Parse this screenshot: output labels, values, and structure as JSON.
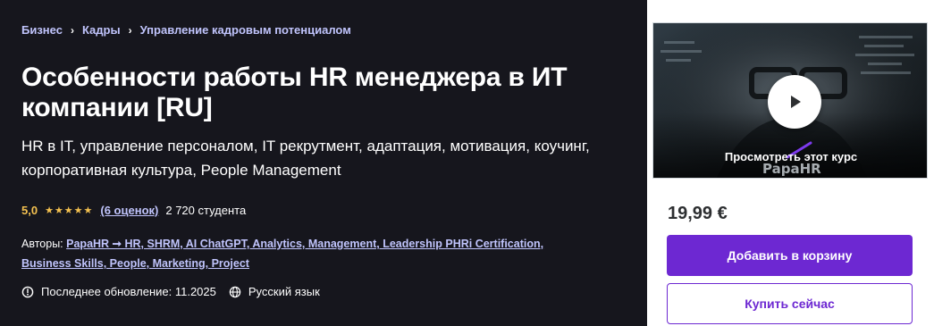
{
  "breadcrumb": {
    "items": [
      "Бизнес",
      "Кадры",
      "Управление кадровым потенциалом"
    ],
    "separator": "›"
  },
  "course": {
    "title": "Особенности работы HR менеджера в ИТ компании [RU]",
    "subtitle": "HR в IT, управление персоналом, IT рекрутмент, адаптация, мотивация, коучинг, корпоративная культура, People Management",
    "rating": "5,0",
    "stars": "★★★★★",
    "reviews_link": "(6 оценок)",
    "students": "2 720 студента",
    "authors_label": "Авторы:",
    "authors_line1": "PapaHR ➞ HR, SHRM, AI ChatGPT, Analytics, Management, Leadership PHRi Certification,",
    "authors_line2": "Business Skills, People, Marketing, Project",
    "last_updated": "Последнее обновление: 11.2025",
    "language": "Русский язык"
  },
  "sidebar": {
    "preview_label": "Просмотреть этот курс",
    "watermark": "PapaHR",
    "price": "19,99 €",
    "add_to_cart": "Добавить в корзину",
    "buy_now": "Купить сейчас"
  },
  "colors": {
    "accent": "#6d28d2",
    "link": "#c0c4fc",
    "star": "#f4c150",
    "hero_bg": "#16161d"
  },
  "icons": {
    "breadcrumb_separator": "chevron-right-icon",
    "update": "clock-alert-icon",
    "language": "globe-icon",
    "preview": "play-icon"
  }
}
